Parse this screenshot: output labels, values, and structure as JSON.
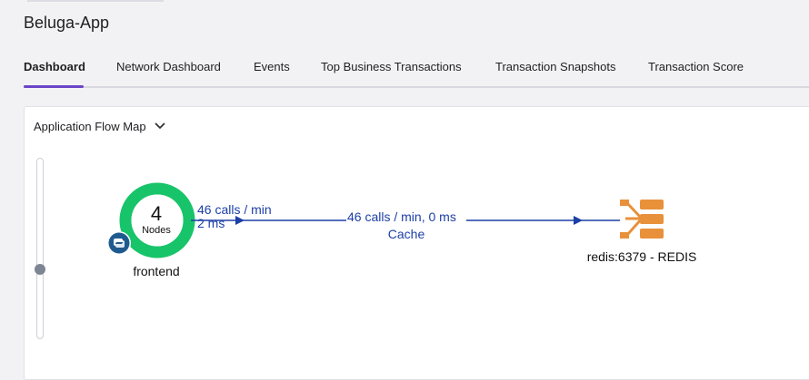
{
  "app": {
    "title": "Beluga-App"
  },
  "tabs": [
    {
      "label": "Dashboard",
      "active": true
    },
    {
      "label": "Network Dashboard",
      "active": false
    },
    {
      "label": "Events",
      "active": false
    },
    {
      "label": "Top Business Transactions",
      "active": false
    },
    {
      "label": "Transaction Snapshots",
      "active": false
    },
    {
      "label": "Transaction Score",
      "active": false
    }
  ],
  "panel": {
    "title": "Application Flow Map",
    "dropdown_icon": "chevron-down-icon"
  },
  "flow_map": {
    "zoom_level": 0.35,
    "tier_node": {
      "count": "4",
      "count_label": "Nodes",
      "name": "frontend",
      "icon": "python-icon",
      "ring_color": "#18c46a",
      "badge_color": "#1f5a8f"
    },
    "edge_out": {
      "calls": "46 calls / min",
      "time": "2 ms",
      "color": "#1c3fa8"
    },
    "edge_in": {
      "calls_time": "46 calls / min, 0 ms",
      "type": "Cache"
    },
    "backend": {
      "name": "redis:6379 - REDIS",
      "icon": "redis-backend-icon",
      "color": "#e8913a"
    }
  },
  "colors": {
    "accent": "#6a45c7",
    "edge": "#1c3fa8",
    "healthy": "#18c46a",
    "backend": "#e8913a"
  }
}
